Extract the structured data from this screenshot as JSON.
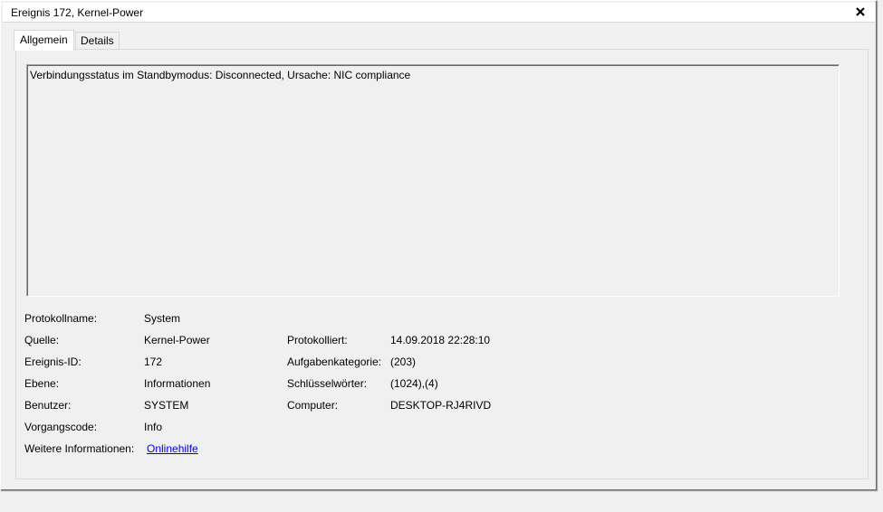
{
  "window": {
    "title": "Ereignis 172, Kernel-Power",
    "close_glyph": "✕"
  },
  "tabs": [
    {
      "label": "Allgemein",
      "active": true
    },
    {
      "label": "Details",
      "active": false
    }
  ],
  "description": "Verbindungsstatus im Standbymodus: Disconnected, Ursache: NIC compliance",
  "fields": {
    "protokollname": {
      "label": "Protokollname:",
      "value": "System"
    },
    "quelle": {
      "label": "Quelle:",
      "value": "Kernel-Power"
    },
    "protokolliert": {
      "label": "Protokolliert:",
      "value": "14.09.2018 22:28:10"
    },
    "ereignis_id": {
      "label": "Ereignis-ID:",
      "value": "172"
    },
    "aufgabenkategorie": {
      "label": "Aufgabenkategorie:",
      "value": "(203)"
    },
    "ebene": {
      "label": "Ebene:",
      "value": "Informationen"
    },
    "schluesselwoerter": {
      "label": "Schlüsselwörter:",
      "value": "(1024),(4)"
    },
    "benutzer": {
      "label": "Benutzer:",
      "value": "SYSTEM"
    },
    "computer": {
      "label": "Computer:",
      "value": "DESKTOP-RJ4RIVD"
    },
    "vorgangscode": {
      "label": "Vorgangscode:",
      "value": "Info"
    },
    "weitere_informationen": {
      "label": "Weitere Informationen:",
      "link": "Onlinehilfe"
    }
  },
  "colors": {
    "background": "#f0f0f0",
    "titlebar": "#ffffff",
    "link": "#0000ee"
  }
}
